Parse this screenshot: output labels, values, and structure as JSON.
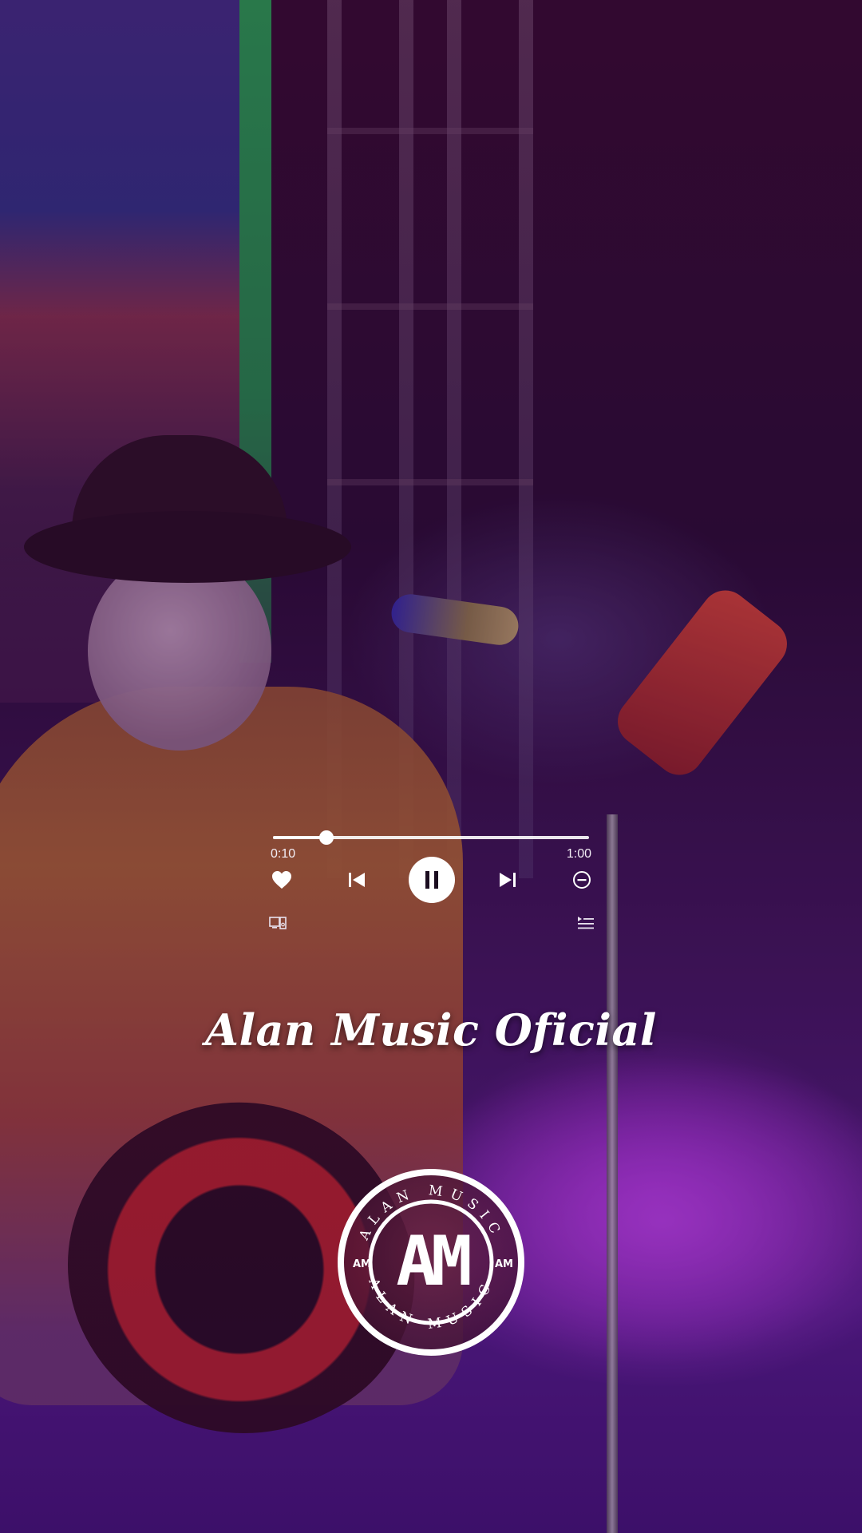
{
  "player": {
    "elapsed": "0:10",
    "total": "1:00",
    "progress_fraction": 0.17,
    "state": "playing"
  },
  "controls": {
    "like_icon": "heart-icon",
    "previous_icon": "skip-previous-icon",
    "pause_icon": "pause-icon",
    "next_icon": "skip-next-icon",
    "hide_icon": "block-icon",
    "devices_icon": "connect-devices-icon",
    "queue_icon": "queue-icon"
  },
  "artist": {
    "name": "Alan Music Oficial"
  },
  "logo": {
    "monogram": "AM",
    "ring_text": "ALAN MUSIC",
    "badge": "AM"
  },
  "colors": {
    "tint": "#4b1b83",
    "controls": "#ffffff",
    "logo_fill": "#5a1a3a"
  }
}
